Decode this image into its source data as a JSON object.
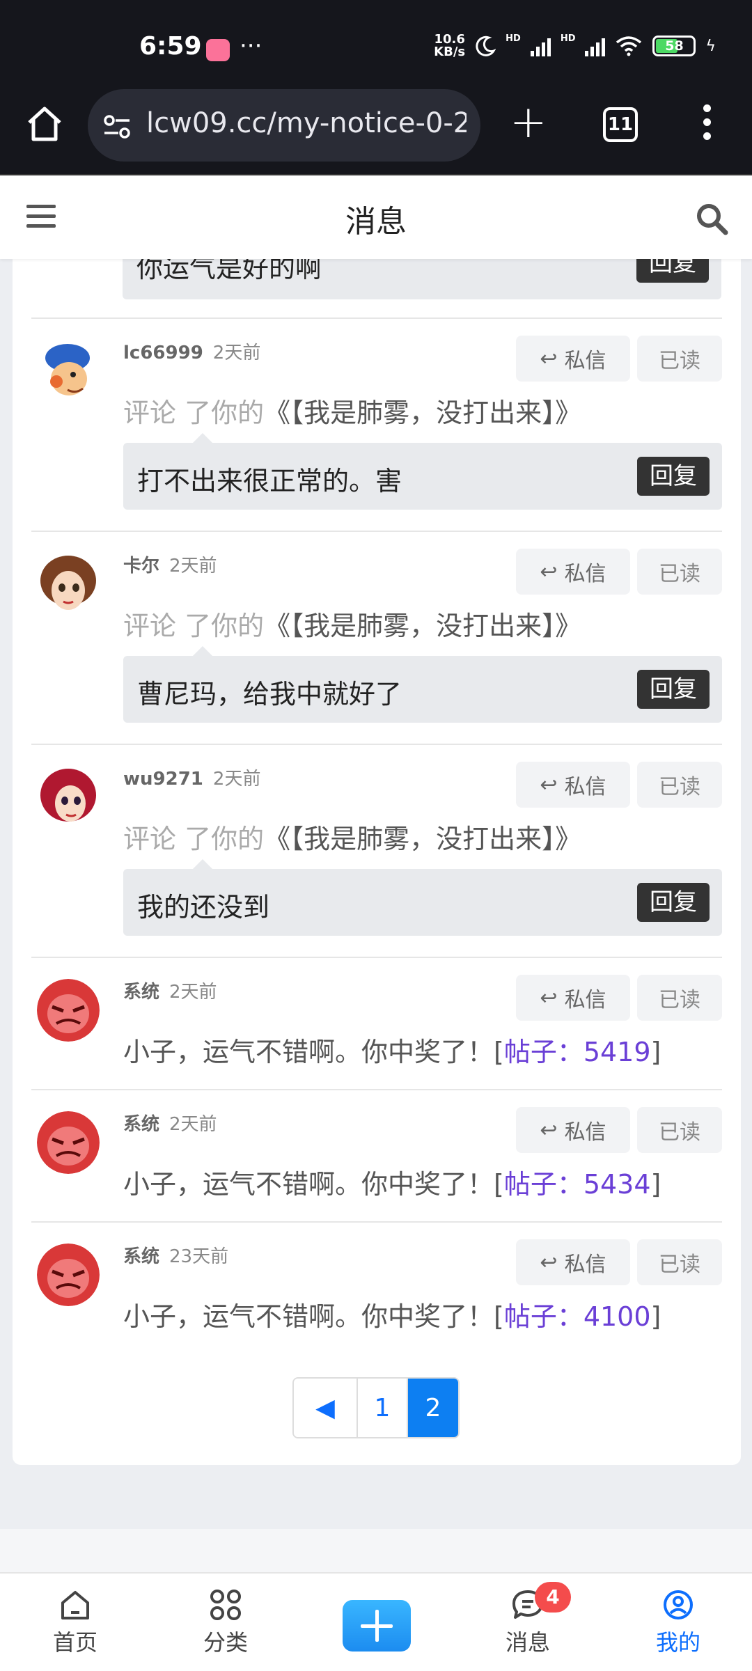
{
  "status_bar": {
    "time": "6:59",
    "net_speed_value": "10.6",
    "net_speed_unit": "KB/s",
    "signal_1": "HD",
    "signal_2": "HD",
    "battery": "58"
  },
  "browser": {
    "url": "lcw09.cc/my-notice-0-2",
    "tab_count": "11"
  },
  "header": {
    "title": "消息"
  },
  "partial_item": {
    "quote": "你运气是好的啊",
    "reply_label": "回复"
  },
  "comments": [
    {
      "user": "lc66999",
      "time": "2天前",
      "pm_label": "私信",
      "read_label": "已读",
      "action_1": "评论",
      "action_2": " 了你的",
      "post": "《【我是肺雾，没打出来】》",
      "quote": "打不出来很正常的。害",
      "reply_label": "回复"
    },
    {
      "user": "卡尔",
      "time": "2天前",
      "pm_label": "私信",
      "read_label": "已读",
      "action_1": "评论",
      "action_2": " 了你的",
      "post": "《【我是肺雾，没打出来】》",
      "quote": "曹尼玛，给我中就好了",
      "reply_label": "回复"
    },
    {
      "user": "wu9271",
      "time": "2天前",
      "pm_label": "私信",
      "read_label": "已读",
      "action_1": "评论",
      "action_2": " 了你的",
      "post": "《【我是肺雾，没打出来】》",
      "quote": "我的还没到",
      "reply_label": "回复"
    }
  ],
  "system_messages": [
    {
      "user": "系统",
      "time": "2天前",
      "pm_label": "私信",
      "read_label": "已读",
      "text": "小子，运气不错啊。你中奖了！[",
      "link": "帖子：5419",
      "text_end": "]"
    },
    {
      "user": "系统",
      "time": "2天前",
      "pm_label": "私信",
      "read_label": "已读",
      "text": "小子，运气不错啊。你中奖了！[",
      "link": "帖子：5434",
      "text_end": "]"
    },
    {
      "user": "系统",
      "time": "23天前",
      "pm_label": "私信",
      "read_label": "已读",
      "text": "小子，运气不错啊。你中奖了！[",
      "link": "帖子：4100",
      "text_end": "]"
    }
  ],
  "pagination": {
    "prev_icon": "◀",
    "pages": [
      "1",
      "2"
    ],
    "active_page": "2"
  },
  "bottom_nav": {
    "home": "首页",
    "category": "分类",
    "messages": "消息",
    "messages_badge": "4",
    "mine": "我的"
  },
  "colors": {
    "accent": "#0d6efd",
    "link": "#6a3fd6",
    "badge": "#f44c4c"
  }
}
